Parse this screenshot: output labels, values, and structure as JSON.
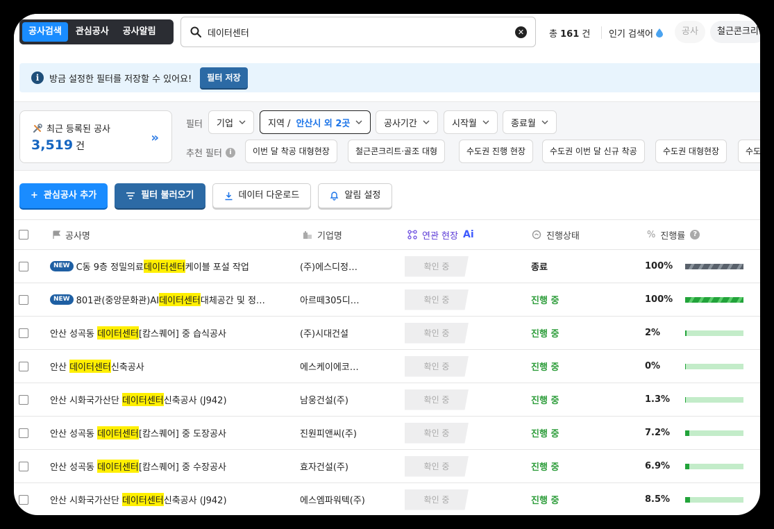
{
  "tabs": [
    {
      "label": "공사검색",
      "active": true
    },
    {
      "label": "관심공사",
      "active": false
    },
    {
      "label": "공사알림",
      "active": false
    }
  ],
  "search": {
    "value": "데이터센터",
    "placeholder": ""
  },
  "count": {
    "prefix": "총",
    "value": "161",
    "suffix": "건"
  },
  "popular": {
    "label": "인기 검색어",
    "chips": [
      "공사",
      "철근콘크리"
    ]
  },
  "notice": {
    "text": "방금 설정한 필터를 저장할 수 있어요!",
    "button": "필터 저장"
  },
  "recent": {
    "label": "최근 등록된 공사",
    "value": "3,519",
    "unit": "건"
  },
  "filters": {
    "label": "필터",
    "items": [
      {
        "label": "기업",
        "value": ""
      },
      {
        "label": "지역 /",
        "value": "안산시 외 2곳"
      },
      {
        "label": "공사기간",
        "value": ""
      },
      {
        "label": "시작월",
        "value": ""
      },
      {
        "label": "종료월",
        "value": ""
      }
    ]
  },
  "recommended": {
    "label": "추천 필터",
    "chips": [
      "이번 달 착공 대형현장",
      "철근콘크리트·골조 대형",
      "수도권 진행 현장",
      "수도권 이번 달 신규 착공",
      "수도권 대형현장",
      "수도권"
    ]
  },
  "actions": {
    "add": "관심공사 추가",
    "load": "필터 불러오기",
    "download": "데이터 다운로드",
    "alert": "알림 설정"
  },
  "columns": {
    "name": "공사명",
    "company": "기업명",
    "related": "연관 현장",
    "related_badge": "Ai",
    "status": "진행상태",
    "progress": "진행률"
  },
  "rows": [
    {
      "new": "NEW",
      "pre": "C동 9층 정밀의료",
      "hl": "데이터센터",
      "post": "케이블 포설 작업",
      "company": "(주)에스디정…",
      "related": "확인 중",
      "status": "종료",
      "progress_label": "100%",
      "progress": 100
    },
    {
      "new": "NEW",
      "pre": "801관(중앙문화관)AI",
      "hl": "데이터센터",
      "post": "대체공간 및 정…",
      "company": "아르떼305디…",
      "related": "확인 중",
      "status": "진행 중",
      "progress_label": "100%",
      "progress": 100
    },
    {
      "new": "",
      "pre": "안산 성곡동 ",
      "hl": "데이터센터",
      "post": "[캄스퀘어] 중 습식공사",
      "company": "(주)시대건설",
      "related": "확인 중",
      "status": "진행 중",
      "progress_label": "2%",
      "progress": 2
    },
    {
      "new": "",
      "pre": "안산 ",
      "hl": "데이터센터",
      "post": "신축공사",
      "company": "에스케이에코…",
      "related": "확인 중",
      "status": "진행 중",
      "progress_label": "0%",
      "progress": 0
    },
    {
      "new": "",
      "pre": "안산 시화국가산단 ",
      "hl": "데이터센터",
      "post": "신축공사 (J942)",
      "company": "남웅건설(주)",
      "related": "확인 중",
      "status": "진행 중",
      "progress_label": "1.3%",
      "progress": 1.3
    },
    {
      "new": "",
      "pre": "안산 성곡동 ",
      "hl": "데이터센터",
      "post": "[캄스퀘어] 중 도장공사",
      "company": "진원피앤씨(주)",
      "related": "확인 중",
      "status": "진행 중",
      "progress_label": "7.2%",
      "progress": 7.2
    },
    {
      "new": "",
      "pre": "안산 성곡동 ",
      "hl": "데이터센터",
      "post": "[캄스퀘어] 중 수장공사",
      "company": "효자건설(주)",
      "related": "확인 중",
      "status": "진행 중",
      "progress_label": "6.9%",
      "progress": 6.9
    },
    {
      "new": "",
      "pre": "안산 시화국가산단 ",
      "hl": "데이터센터",
      "post": "신축공사 (J942)",
      "company": "에스엠파워텍(주)",
      "related": "확인 중",
      "status": "진행 중",
      "progress_label": "8.5%",
      "progress": 8.5
    }
  ]
}
